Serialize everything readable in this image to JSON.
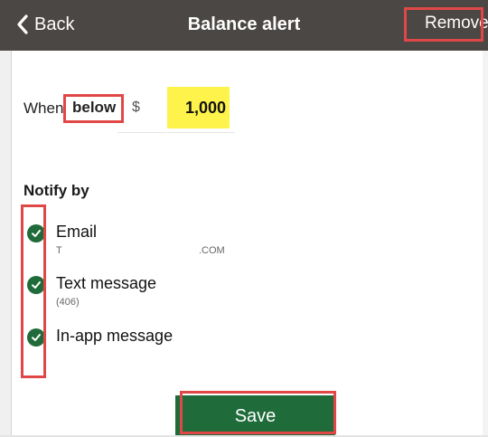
{
  "nav": {
    "back_label": "Back",
    "title": "Balance alert",
    "remove_label": "Remove"
  },
  "threshold": {
    "when_label": "When",
    "condition": "below",
    "currency_symbol": "$",
    "amount": "1,000"
  },
  "notify": {
    "heading": "Notify by",
    "options": [
      {
        "label": "Email",
        "detail_start": "T",
        "detail_end": ".COM",
        "checked": true
      },
      {
        "label": "Text message",
        "detail": "(406)",
        "checked": true
      },
      {
        "label": "In-app message",
        "checked": true
      }
    ]
  },
  "actions": {
    "save_label": "Save"
  },
  "colors": {
    "navbar": "#4a4744",
    "accent_green": "#1f6b3a",
    "highlight_yellow": "#fdf34a",
    "annotation_red": "#e04848"
  }
}
